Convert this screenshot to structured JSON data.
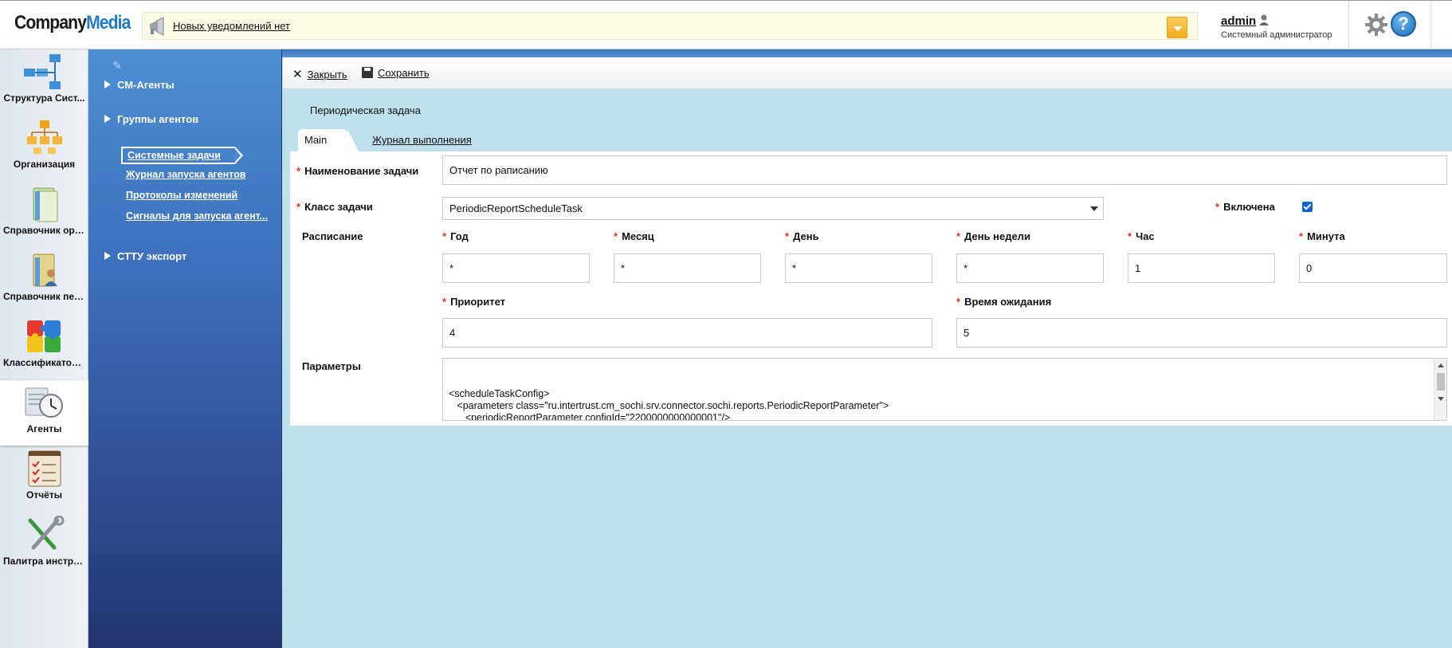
{
  "header": {
    "logo_part1": "Company",
    "logo_part2": "Media",
    "notification_text": "Новых уведомлений нет",
    "user_name": "admin",
    "user_role": "Системный администратор",
    "help_label": "?"
  },
  "rail": {
    "items": [
      {
        "label": "Структура Сист...",
        "icon": "system-structure-icon"
      },
      {
        "label": "Организация",
        "icon": "organization-icon"
      },
      {
        "label": "Справочник орг...",
        "icon": "org-directory-icon"
      },
      {
        "label": "Справочник пер...",
        "icon": "personnel-directory-icon"
      },
      {
        "label": "Классификаторы",
        "icon": "classifiers-icon"
      },
      {
        "label": "Агенты",
        "icon": "agents-icon"
      },
      {
        "label": "Отчёты",
        "icon": "reports-icon"
      },
      {
        "label": "Палитра инстру...",
        "icon": "tools-palette-icon"
      }
    ],
    "active_index": 5
  },
  "nav": {
    "groups": [
      "СМ-Агенты",
      "Группы агентов",
      "СТТУ экспорт"
    ],
    "links": [
      "Системные задачи",
      "Журнал запуска агентов",
      "Протоколы изменений",
      "Сигналы для запуска агент..."
    ],
    "selected_link": "Системные задачи"
  },
  "toolbar": {
    "close_label": "Закрыть",
    "save_label": "Сохранить"
  },
  "form": {
    "title": "Периодическая задача",
    "tabs": {
      "main": "Main",
      "log": "Журнал выполнения"
    },
    "task_name_label": "Наименование задачи",
    "task_name_value": "Отчет по раписанию",
    "task_class_label": "Класс задачи",
    "task_class_value": "PeriodicReportScheduleTask",
    "enabled_label": "Включена",
    "enabled": true,
    "schedule_label": "Расписание",
    "year_label": "Год",
    "year_value": "*",
    "month_label": "Месяц",
    "month_value": "*",
    "day_label": "День",
    "day_value": "*",
    "weekday_label": "День недели",
    "weekday_value": "*",
    "hour_label": "Час",
    "hour_value": "1",
    "minute_label": "Минута",
    "minute_value": "0",
    "priority_label": "Приоритет",
    "priority_value": "4",
    "timeout_label": "Время ожидания",
    "timeout_value": "5",
    "params_label": "Параметры",
    "params_value": "<scheduleTaskConfig>\n   <parameters class=\"ru.intertrust.cm_sochi.srv.connector.sochi.reports.PeriodicReportParameter\">\n      <periodicReportParameter configId=\"2200000000000001\"/>\n   </parameters>\n</scheduleTaskConfig>"
  }
}
